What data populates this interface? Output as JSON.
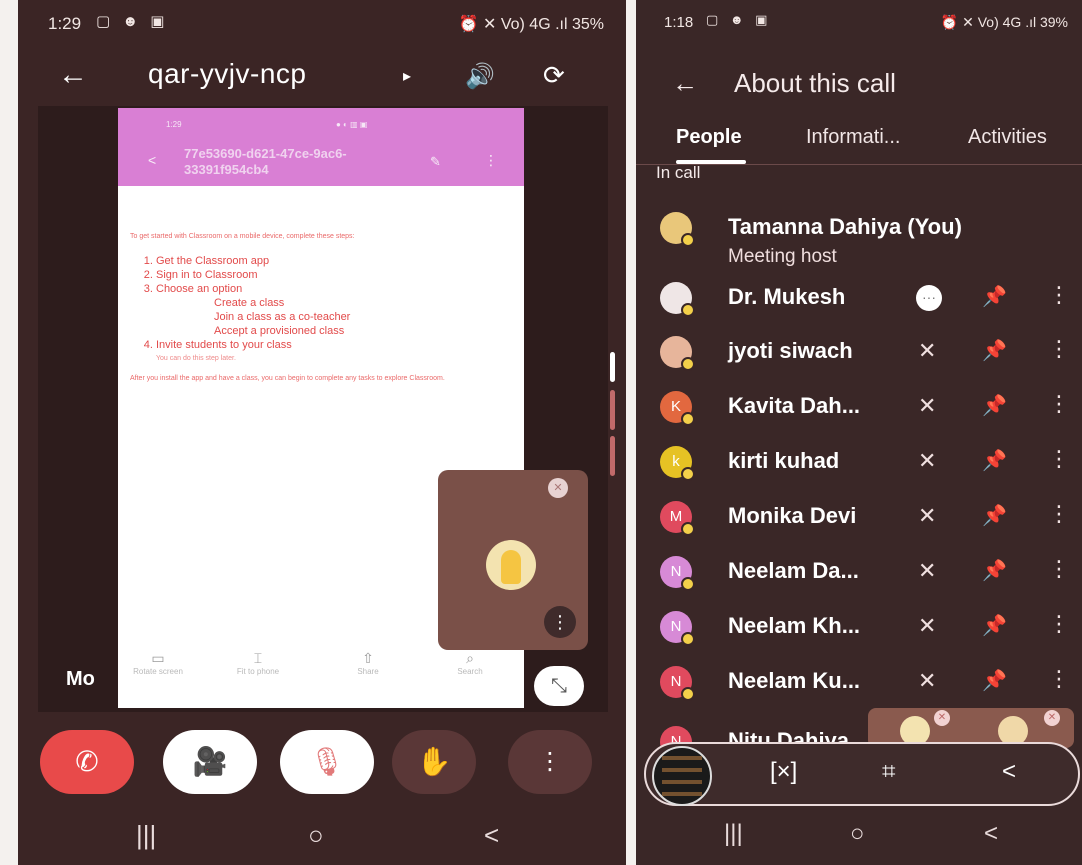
{
  "left_screen": {
    "status": {
      "time": "1:29",
      "icons": "▢ ☻ ▣",
      "right": "⏰ ✕ Vo) 4G .ıl 35%"
    },
    "header": {
      "back_icon": "←",
      "title": "qar-yvjv-ncp",
      "caret": "▸",
      "speaker_icon": "🔊",
      "rotate_icon": "⟳"
    },
    "doc": {
      "status_time": "1:29",
      "status_icons": "● ◐ ▥ ▣",
      "back": "<",
      "title": "77e53690-d621-47ce-9ac6-33391f954cb4",
      "edit_icon": "✎",
      "more_icon": "⋮",
      "intro": "To get started with Classroom on a mobile device, complete these steps:",
      "steps": [
        "Get the Classroom app",
        "Sign in to Classroom",
        "Choose an option",
        "Invite students to your class"
      ],
      "options": [
        "Create a class",
        "Join a class as a co-teacher",
        "Accept a provisioned class"
      ],
      "invite_note": "You can do this step later.",
      "footer": "After you install the app and have a class, you can begin to complete any tasks to explore Classroom.",
      "tools": [
        {
          "icon": "▭",
          "label": "Rotate screen"
        },
        {
          "icon": "⌶",
          "label": "Fit to phone"
        },
        {
          "icon": "⇧",
          "label": "Share"
        },
        {
          "icon": "⌕",
          "label": "Search"
        }
      ]
    },
    "presenter_label": "Mo",
    "self_tile": {
      "mic_icon": "✕",
      "more_icon": "⋮"
    },
    "collapse_icon": "⤡",
    "controls": {
      "end": "✆",
      "camera": "🎥",
      "mic": "🎙",
      "hand": "✋",
      "more": "⋮"
    },
    "nav": {
      "recents": "|||",
      "home": "○",
      "back": "<"
    }
  },
  "right_screen": {
    "status": {
      "time": "1:18",
      "icons": "▢ ☻ ▣",
      "right": "⏰ ✕ Vo) 4G .ıl 39%"
    },
    "header": {
      "back_icon": "←",
      "title": "About this call"
    },
    "tabs": [
      "People",
      "Informati...",
      "Activities"
    ],
    "section_label": "In call",
    "participants": [
      {
        "name": "Tamanna Dahiya (You)",
        "role": "Meeting host",
        "avatar_color": "#e9c77a",
        "initial": ""
      },
      {
        "name": "Dr. Mukesh",
        "avatar_color": "#efe6e6",
        "initial": "",
        "more_badge": "···"
      },
      {
        "name": "jyoti siwach",
        "avatar_color": "#e7b59b",
        "initial": ""
      },
      {
        "name": "Kavita Dah...",
        "avatar_color": "#e2683f",
        "initial": "K"
      },
      {
        "name": "kirti kuhad",
        "avatar_color": "#e6c224",
        "initial": "k"
      },
      {
        "name": "Monika Devi",
        "avatar_color": "#e04a5e",
        "initial": "M"
      },
      {
        "name": "Neelam Da...",
        "avatar_color": "#d78ad6",
        "initial": "N"
      },
      {
        "name": "Neelam Kh...",
        "avatar_color": "#d78ad6",
        "initial": "N"
      },
      {
        "name": "Neelam Ku...",
        "avatar_color": "#e04a5e",
        "initial": "N"
      },
      {
        "name": "Nitu Dahiya",
        "avatar_color": "#e04a5e",
        "initial": "N"
      }
    ],
    "icons": {
      "mute": "✕",
      "pin": "📌",
      "kebab": "⋮"
    },
    "toolbar": {
      "scan_icon": "[×]",
      "crop_icon": "⌗",
      "share_icon": "<"
    },
    "nav": {
      "recents": "|||",
      "home": "○",
      "back": "<"
    }
  }
}
